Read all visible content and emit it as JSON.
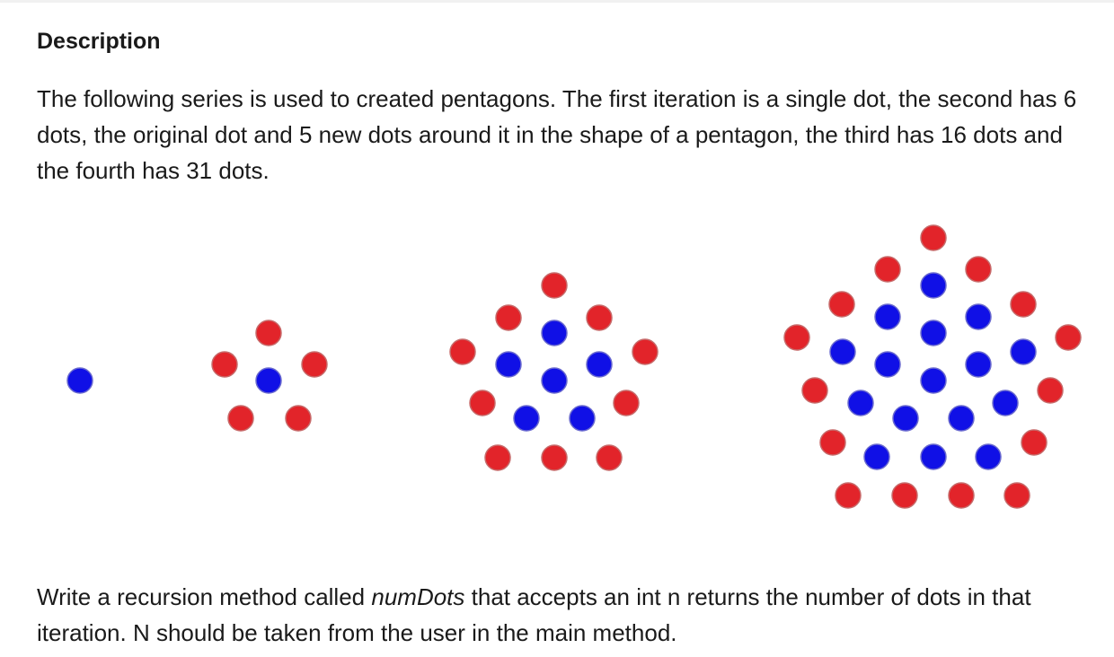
{
  "heading": "Description",
  "intro": "The following series is used to created pentagons. The first iteration is a single dot, the second has 6 dots, the original dot and 5 new dots around it in the shape of a pentagon, the third has 16 dots and the fourth has 31 dots.",
  "task": {
    "before": "Write a recursion method called ",
    "method": "numDots",
    "after": " that accepts an int n returns the number of dots in that iteration. N should be taken from the user in the main method."
  },
  "colors": {
    "inner_dot": "#1010e6",
    "outer_dot": "#e2242a",
    "dot_outline_inner": "#6a6acf",
    "dot_outline_outer": "#c76a6a"
  },
  "figure": {
    "iterations": [
      {
        "iteration": 1,
        "dots": 1
      },
      {
        "iteration": 2,
        "dots": 6
      },
      {
        "iteration": 3,
        "dots": 16
      },
      {
        "iteration": 4,
        "dots": 31
      }
    ]
  }
}
